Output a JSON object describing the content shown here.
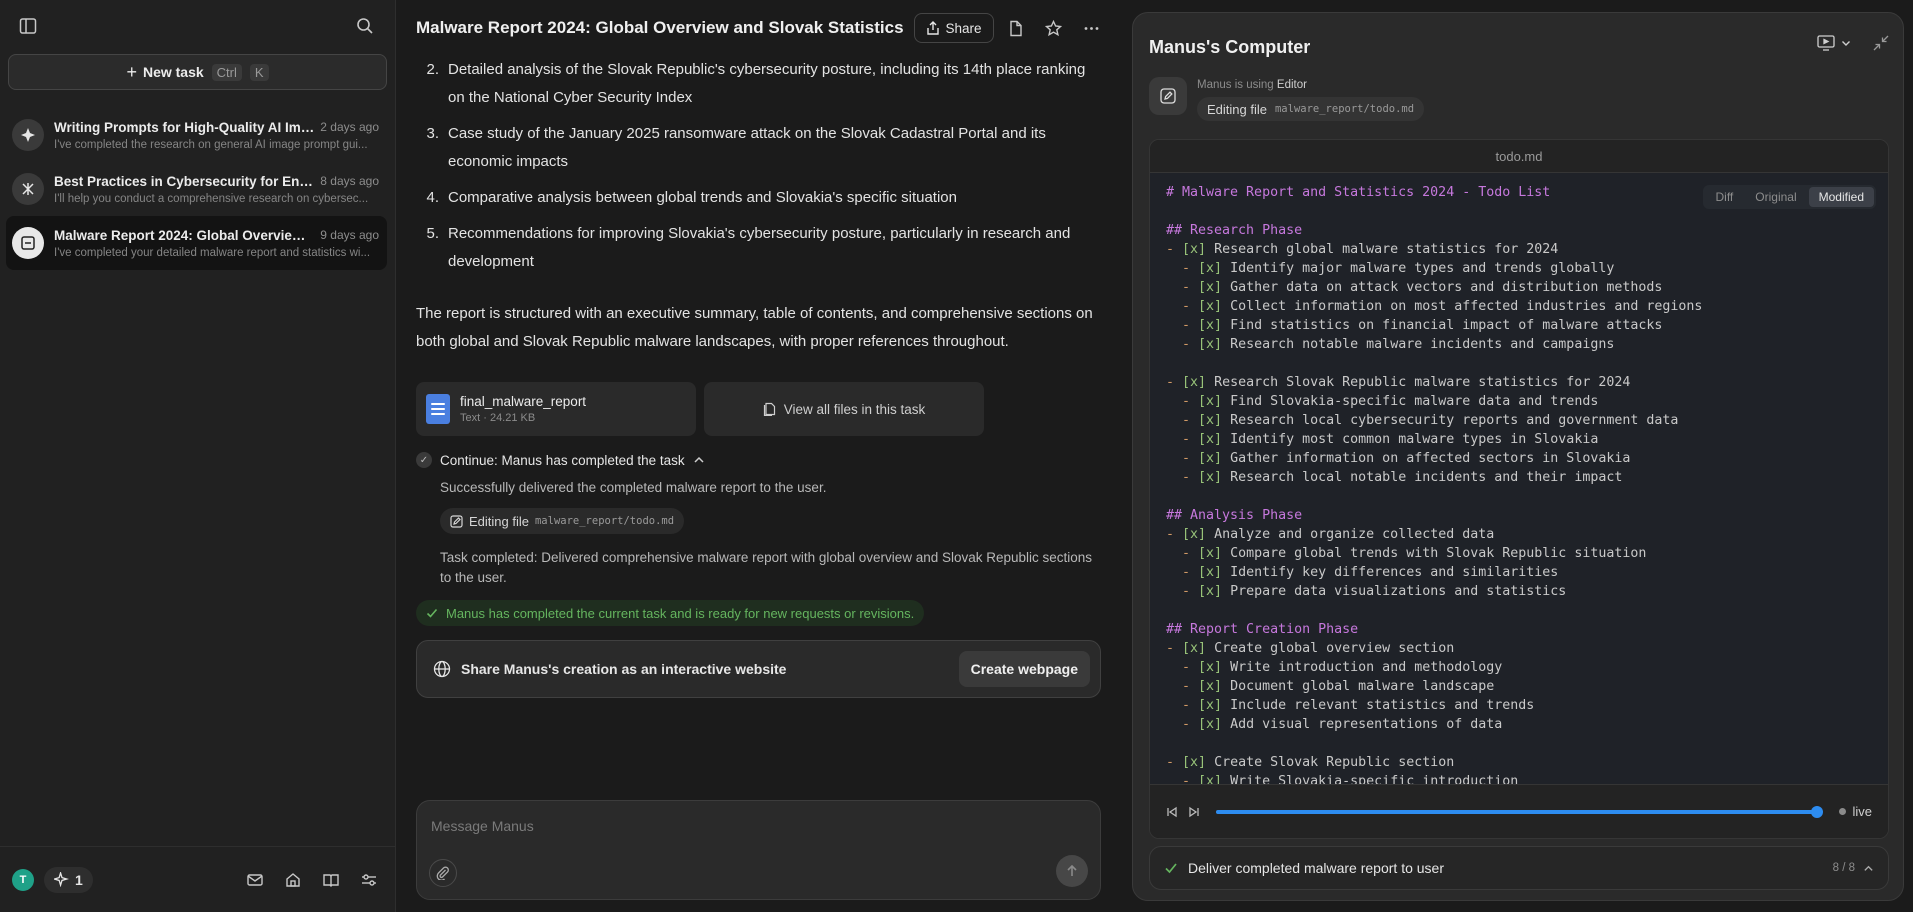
{
  "sidebar": {
    "new_task_label": "New task",
    "shortcut_ctrl": "Ctrl",
    "shortcut_key": "K",
    "tasks": [
      {
        "title": "Writing Prompts for High-Quality AI Ima...",
        "date": "2 days ago",
        "preview": "I've completed the research on general AI image prompt gui..."
      },
      {
        "title": "Best Practices in Cybersecurity for Engi...",
        "date": "8 days ago",
        "preview": "I'll help you conduct a comprehensive research on cybersec..."
      },
      {
        "title": "Malware Report 2024: Global Overview a...",
        "date": "9 days ago",
        "preview": "I've completed your detailed malware report and statistics wi..."
      }
    ],
    "user_initial": "T",
    "credits": "1"
  },
  "header": {
    "title": "Malware Report 2024: Global Overview and Slovak Statistics",
    "share_label": "Share"
  },
  "chat": {
    "list_items": [
      {
        "num": "2.",
        "text": "Detailed analysis of the Slovak Republic's cybersecurity posture, including its 14th place ranking on the National Cyber Security Index"
      },
      {
        "num": "3.",
        "text": "Case study of the January 2025 ransomware attack on the Slovak Cadastral Portal and its economic impacts"
      },
      {
        "num": "4.",
        "text": "Comparative analysis between global trends and Slovakia's specific situation"
      },
      {
        "num": "5.",
        "text": "Recommendations for improving Slovakia's cybersecurity posture, particularly in research and development"
      }
    ],
    "paragraph": "The report is structured with an executive summary, table of contents, and comprehensive sections on both global and Slovak Republic malware landscapes, with proper references throughout.",
    "file": {
      "name": "final_malware_report",
      "meta": "Text · 24.21 KB"
    },
    "view_all_label": "View all files in this task",
    "step_title": "Continue: Manus has completed the task",
    "step_text_1": "Successfully delivered the completed malware report to the user.",
    "tool_label": "Editing file",
    "tool_path": "malware_report/todo.md",
    "step_text_2": "Task completed: Delivered comprehensive malware report with global overview and Slovak Republic sections to the user.",
    "done_message": "Manus has completed the current task and is ready for new requests or revisions.",
    "share_web_label": "Share Manus's creation as an interactive website",
    "create_webpage_label": "Create webpage"
  },
  "composer": {
    "placeholder": "Message Manus"
  },
  "computer": {
    "title": "Manus's Computer",
    "using_prefix": "Manus is using",
    "using_tool": "Editor",
    "chip_label": "Editing file",
    "chip_path": "malware_report/todo.md",
    "file_tab": "todo.md",
    "view_modes": [
      "Diff",
      "Original",
      "Modified"
    ],
    "active_view": "Modified",
    "code_lines": [
      "# Malware Report and Statistics 2024 - Todo List",
      "",
      "## Research Phase",
      "- [x] Research global malware statistics for 2024",
      "  - [x] Identify major malware types and trends globally",
      "  - [x] Gather data on attack vectors and distribution methods",
      "  - [x] Collect information on most affected industries and regions",
      "  - [x] Find statistics on financial impact of malware attacks",
      "  - [x] Research notable malware incidents and campaigns",
      "",
      "- [x] Research Slovak Republic malware statistics for 2024",
      "  - [x] Find Slovakia-specific malware data and trends",
      "  - [x] Research local cybersecurity reports and government data",
      "  - [x] Identify most common malware types in Slovakia",
      "  - [x] Gather information on affected sectors in Slovakia",
      "  - [x] Research local notable incidents and their impact",
      "",
      "## Analysis Phase",
      "- [x] Analyze and organize collected data",
      "  - [x] Compare global trends with Slovak Republic situation",
      "  - [x] Identify key differences and similarities",
      "  - [x] Prepare data visualizations and statistics",
      "",
      "## Report Creation Phase",
      "- [x] Create global overview section",
      "  - [x] Write introduction and methodology",
      "  - [x] Document global malware landscape",
      "  - [x] Include relevant statistics and trends",
      "  - [x] Add visual representations of data",
      "",
      "- [x] Create Slovak Republic section",
      "  - [x] Write Slovakia-specific introduction"
    ],
    "playback_progress": 0.99,
    "live_label": "live",
    "final_step": "Deliver completed malware report to user",
    "step_count": "8 / 8"
  }
}
